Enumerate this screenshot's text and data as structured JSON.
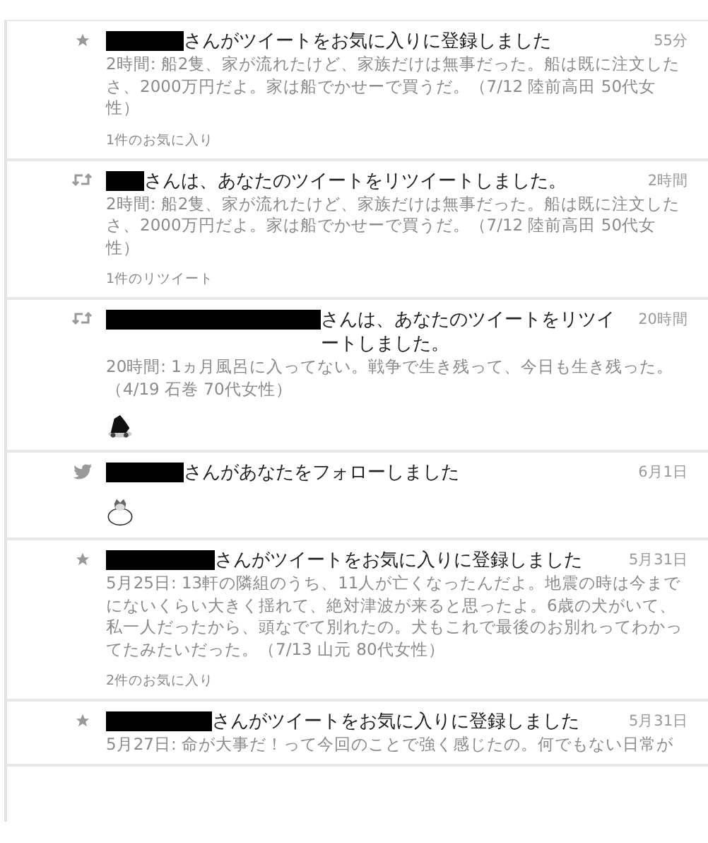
{
  "notifications": [
    {
      "kind": "favorite",
      "title": "さんがツイートをお気に入りに登録しました",
      "time": "55分",
      "body": "2時間: 船2隻、家が流れたけど、家族だけは無事だった。船は既に注文したさ、2000万円だよ。家は船でかせーで買うだ。（7/12 陸前高田 50代女性）",
      "footer": "1件のお気に入り"
    },
    {
      "kind": "retweet",
      "title": "さんは、あなたのツイートをリツイートしました。",
      "time": "2時間",
      "body": "2時間: 船2隻、家が流れたけど、家族だけは無事だった。船は既に注文したさ、2000万円だよ。家は船でかせーで買うだ。（7/12 陸前高田 50代女性）",
      "footer": "1件のリツイート"
    },
    {
      "kind": "retweet",
      "title": "さんは、あなたのツイートをリツイートしました。",
      "time": "20時間",
      "body": "20時間: 1ヵ月風呂に入ってない。戦争で生き残って、今日も生き残った。（4/19 石巻 70代女性）"
    },
    {
      "kind": "follow",
      "title": "さんがあなたをフォローしました",
      "time": "6月1日"
    },
    {
      "kind": "favorite",
      "title": "さんがツイートをお気に入りに登録しました",
      "time": "5月31日",
      "body": "5月25日: 13軒の隣組のうち、11人が亡くなったんだよ。地震の時は今までにないくらい大きく揺れて、絶対津波が来ると思ったよ。6歳の犬がいて、私一人だったから、頭なでて別れたの。犬もこれで最後のお別れってわかってたみたいだった。（7/13 山元 80代女性）",
      "footer": "2件のお気に入り"
    },
    {
      "kind": "favorite",
      "title": "さんがツイートをお気に入りに登録しました",
      "time": "5月31日",
      "body": "5月27日: 命が大事だ！って今回のことで強く感じたの。何でもない日常が"
    }
  ]
}
